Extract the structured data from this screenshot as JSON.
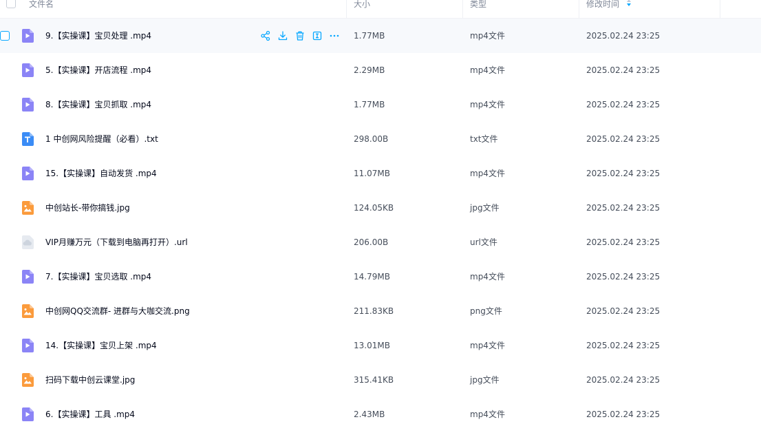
{
  "columns": {
    "name": "文件名",
    "size": "大小",
    "type": "类型",
    "modified": "修改时间"
  },
  "colors": {
    "video": "#8b84f6",
    "text": "#3a8cf6",
    "image": "#fb9b3c",
    "link": "#cdd4de",
    "accent": "#06a7ff"
  },
  "row_actions": [
    "share-icon",
    "download-icon",
    "delete-icon",
    "rename-icon",
    "more-icon"
  ],
  "files": [
    {
      "name": "9.【实操课】宝贝处理 .mp4",
      "size": "1.77MB",
      "type": "mp4文件",
      "time": "2025.02.24 23:25",
      "icon": "video-file-icon"
    },
    {
      "name": "5.【实操课】开店流程 .mp4",
      "size": "2.29MB",
      "type": "mp4文件",
      "time": "2025.02.24 23:25",
      "icon": "video-file-icon"
    },
    {
      "name": "8.【实操课】宝贝抓取 .mp4",
      "size": "1.77MB",
      "type": "mp4文件",
      "time": "2025.02.24 23:25",
      "icon": "video-file-icon"
    },
    {
      "name": "1 中创网风险提醒（必看）.txt",
      "size": "298.00B",
      "type": "txt文件",
      "time": "2025.02.24 23:25",
      "icon": "text-file-icon"
    },
    {
      "name": "15.【实操课】自动发货 .mp4",
      "size": "11.07MB",
      "type": "mp4文件",
      "time": "2025.02.24 23:25",
      "icon": "video-file-icon"
    },
    {
      "name": "中创站长-带你搞钱.jpg",
      "size": "124.05KB",
      "type": "jpg文件",
      "time": "2025.02.24 23:25",
      "icon": "image-file-icon"
    },
    {
      "name": "VIP月赚万元（下载到电脑再打开）.url",
      "size": "206.00B",
      "type": "url文件",
      "time": "2025.02.24 23:25",
      "icon": "cloud-link-icon"
    },
    {
      "name": "7.【实操课】宝贝选取 .mp4",
      "size": "14.79MB",
      "type": "mp4文件",
      "time": "2025.02.24 23:25",
      "icon": "video-file-icon"
    },
    {
      "name": "中创网QQ交流群- 进群与大咖交流.png",
      "size": "211.83KB",
      "type": "png文件",
      "time": "2025.02.24 23:25",
      "icon": "image-file-icon"
    },
    {
      "name": "14.【实操课】宝贝上架 .mp4",
      "size": "13.01MB",
      "type": "mp4文件",
      "time": "2025.02.24 23:25",
      "icon": "video-file-icon"
    },
    {
      "name": "扫码下载中创云课堂.jpg",
      "size": "315.41KB",
      "type": "jpg文件",
      "time": "2025.02.24 23:25",
      "icon": "image-file-icon"
    },
    {
      "name": "6.【实操课】工具 .mp4",
      "size": "2.43MB",
      "type": "mp4文件",
      "time": "2025.02.24 23:25",
      "icon": "video-file-icon"
    }
  ]
}
